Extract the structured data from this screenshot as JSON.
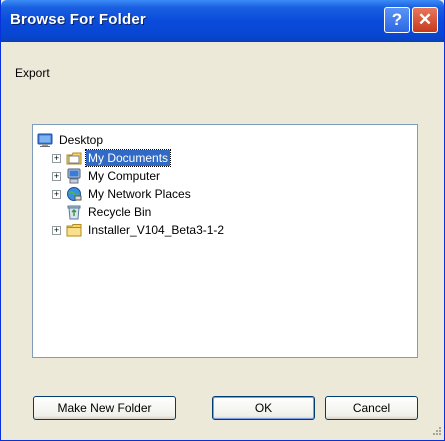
{
  "window": {
    "title": "Browse For Folder",
    "help_glyph": "?",
    "close_glyph": "✕"
  },
  "prompt": "Export",
  "tree": {
    "items": [
      {
        "label": "Desktop",
        "icon": "desktop-icon",
        "expander": "",
        "selected": false
      },
      {
        "label": "My Documents",
        "icon": "my-documents-icon",
        "expander": "+",
        "selected": true
      },
      {
        "label": "My Computer",
        "icon": "my-computer-icon",
        "expander": "+",
        "selected": false
      },
      {
        "label": "My Network Places",
        "icon": "network-places-icon",
        "expander": "+",
        "selected": false
      },
      {
        "label": "Recycle Bin",
        "icon": "recycle-bin-icon",
        "expander": "",
        "selected": false
      },
      {
        "label": "Installer_V104_Beta3-1-2",
        "icon": "folder-icon",
        "expander": "+",
        "selected": false
      }
    ]
  },
  "buttons": {
    "new_folder": "Make New Folder",
    "ok": "OK",
    "cancel": "Cancel"
  },
  "colors": {
    "title_bar": "#0A4BDB",
    "selection": "#316AC5",
    "dialog_bg": "#ECE9D8"
  }
}
